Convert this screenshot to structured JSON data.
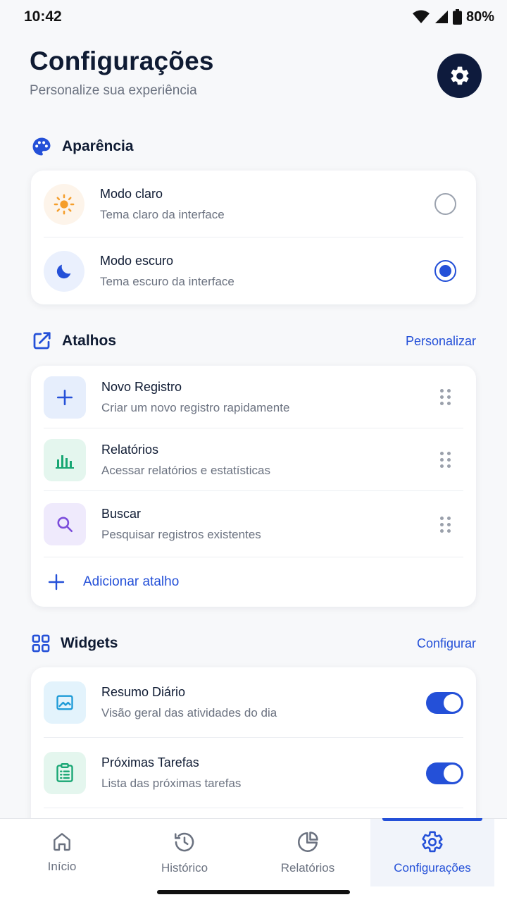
{
  "status": {
    "time": "10:42",
    "battery": "80%"
  },
  "header": {
    "title": "Configurações",
    "subtitle": "Personalize sua experiência"
  },
  "appearance": {
    "title": "Aparência",
    "options": [
      {
        "title": "Modo claro",
        "desc": "Tema claro da interface",
        "selected": false,
        "icon": "sun-icon"
      },
      {
        "title": "Modo escuro",
        "desc": "Tema escuro da interface",
        "selected": true,
        "icon": "moon-icon"
      }
    ]
  },
  "shortcuts": {
    "title": "Atalhos",
    "action": "Personalizar",
    "items": [
      {
        "title": "Novo Registro",
        "desc": "Criar um novo registro rapidamente",
        "icon": "plus-icon"
      },
      {
        "title": "Relatórios",
        "desc": "Acessar relatórios e estatísticas",
        "icon": "bar-chart-icon"
      },
      {
        "title": "Buscar",
        "desc": "Pesquisar registros existentes",
        "icon": "search-icon"
      }
    ],
    "add_label": "Adicionar atalho"
  },
  "widgets": {
    "title": "Widgets",
    "action": "Configurar",
    "items": [
      {
        "title": "Resumo Diário",
        "desc": "Visão geral das atividades do dia",
        "enabled": true,
        "icon": "image-icon"
      },
      {
        "title": "Próximas Tarefas",
        "desc": "Lista das próximas tarefas",
        "enabled": true,
        "icon": "clipboard-list-icon"
      }
    ]
  },
  "nav": {
    "items": [
      {
        "label": "Início",
        "icon": "home-icon"
      },
      {
        "label": "Histórico",
        "icon": "history-icon"
      },
      {
        "label": "Relatórios",
        "icon": "pie-chart-icon"
      },
      {
        "label": "Configurações",
        "icon": "gear-icon",
        "active": true
      }
    ]
  },
  "colors": {
    "accent": "#2450D8",
    "header_button": "#0E1B3D",
    "background": "#F7F8FA"
  }
}
